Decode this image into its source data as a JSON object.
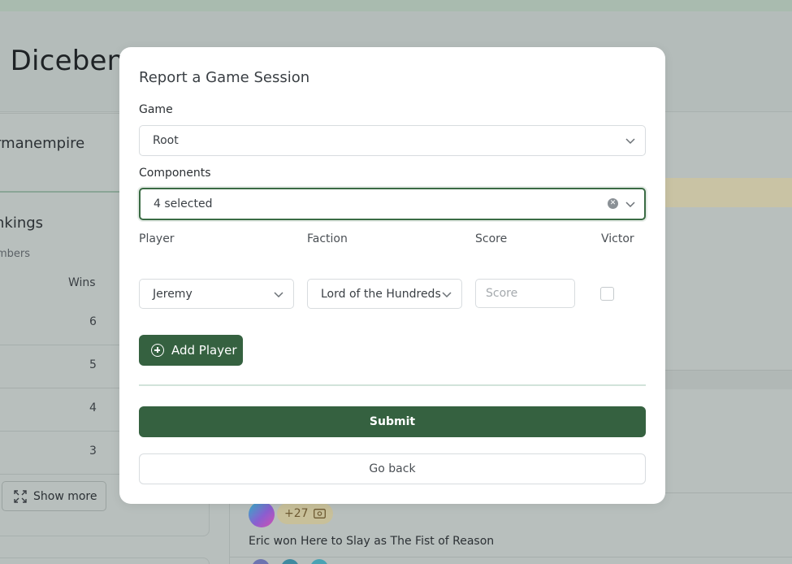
{
  "background": {
    "page_title": "l Dicebene",
    "username": "rmanempire",
    "rankings_title": "nkings",
    "rankings_subtitle": "mbers",
    "wins_header": "Wins",
    "wins": [
      "6",
      "5",
      "4",
      "3"
    ],
    "show_more": "Show more",
    "points_badge": "+27",
    "activity_text": "Eric won Here to Slay as The Fist of Reason"
  },
  "modal": {
    "title": "Report a Game Session",
    "game_label": "Game",
    "game_value": "Root",
    "components_label": "Components",
    "components_value": "4 selected",
    "columns": {
      "player": "Player",
      "faction": "Faction",
      "score": "Score",
      "victor": "Victor"
    },
    "player_row": {
      "player": "Jeremy",
      "faction": "Lord of the Hundreds",
      "score_placeholder": "Score",
      "victor_checked": false
    },
    "add_player": "Add Player",
    "submit": "Submit",
    "go_back": "Go back"
  },
  "colors": {
    "primary": "#356140",
    "overlay": "#b8bfbd",
    "badge": "#c8c09a"
  }
}
